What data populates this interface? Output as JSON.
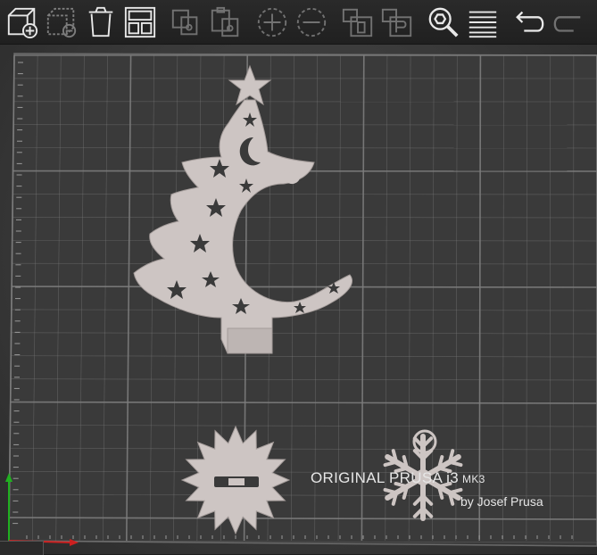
{
  "toolbar": {
    "buttons": [
      {
        "name": "add-object",
        "icon": "add-box-icon"
      },
      {
        "name": "delete",
        "icon": "delete-box-icon"
      },
      {
        "name": "delete-all",
        "icon": "trash-icon"
      },
      {
        "name": "arrange",
        "icon": "arrange-grid-icon"
      },
      {
        "name": "copy",
        "icon": "copy-icon"
      },
      {
        "name": "paste",
        "icon": "paste-icon"
      },
      {
        "name": "add-instance",
        "icon": "plus-circle-icon"
      },
      {
        "name": "remove-instance",
        "icon": "minus-circle-icon"
      },
      {
        "name": "split-objects",
        "icon": "split-objects-icon"
      },
      {
        "name": "split-parts",
        "icon": "split-parts-icon"
      },
      {
        "name": "search",
        "icon": "search-icon"
      },
      {
        "name": "layers-editing",
        "icon": "layers-icon"
      },
      {
        "name": "undo",
        "icon": "undo-icon"
      },
      {
        "name": "redo",
        "icon": "redo-icon"
      }
    ]
  },
  "bed": {
    "brand": "ORIGINAL PRUSA i3",
    "model": "MK3",
    "subtitle": "by Josef Prusa"
  },
  "objects": [
    {
      "name": "christmas-tree-moon-ornament"
    },
    {
      "name": "star-badge-ornament"
    },
    {
      "name": "snowflake-ornament"
    }
  ],
  "colors": {
    "bed": "#3c3c3c",
    "grid": "#8a8a8a",
    "model": "#cdc5c3",
    "toolbar": "#222222",
    "axis_x": "#cc2020",
    "axis_y": "#20b020"
  }
}
